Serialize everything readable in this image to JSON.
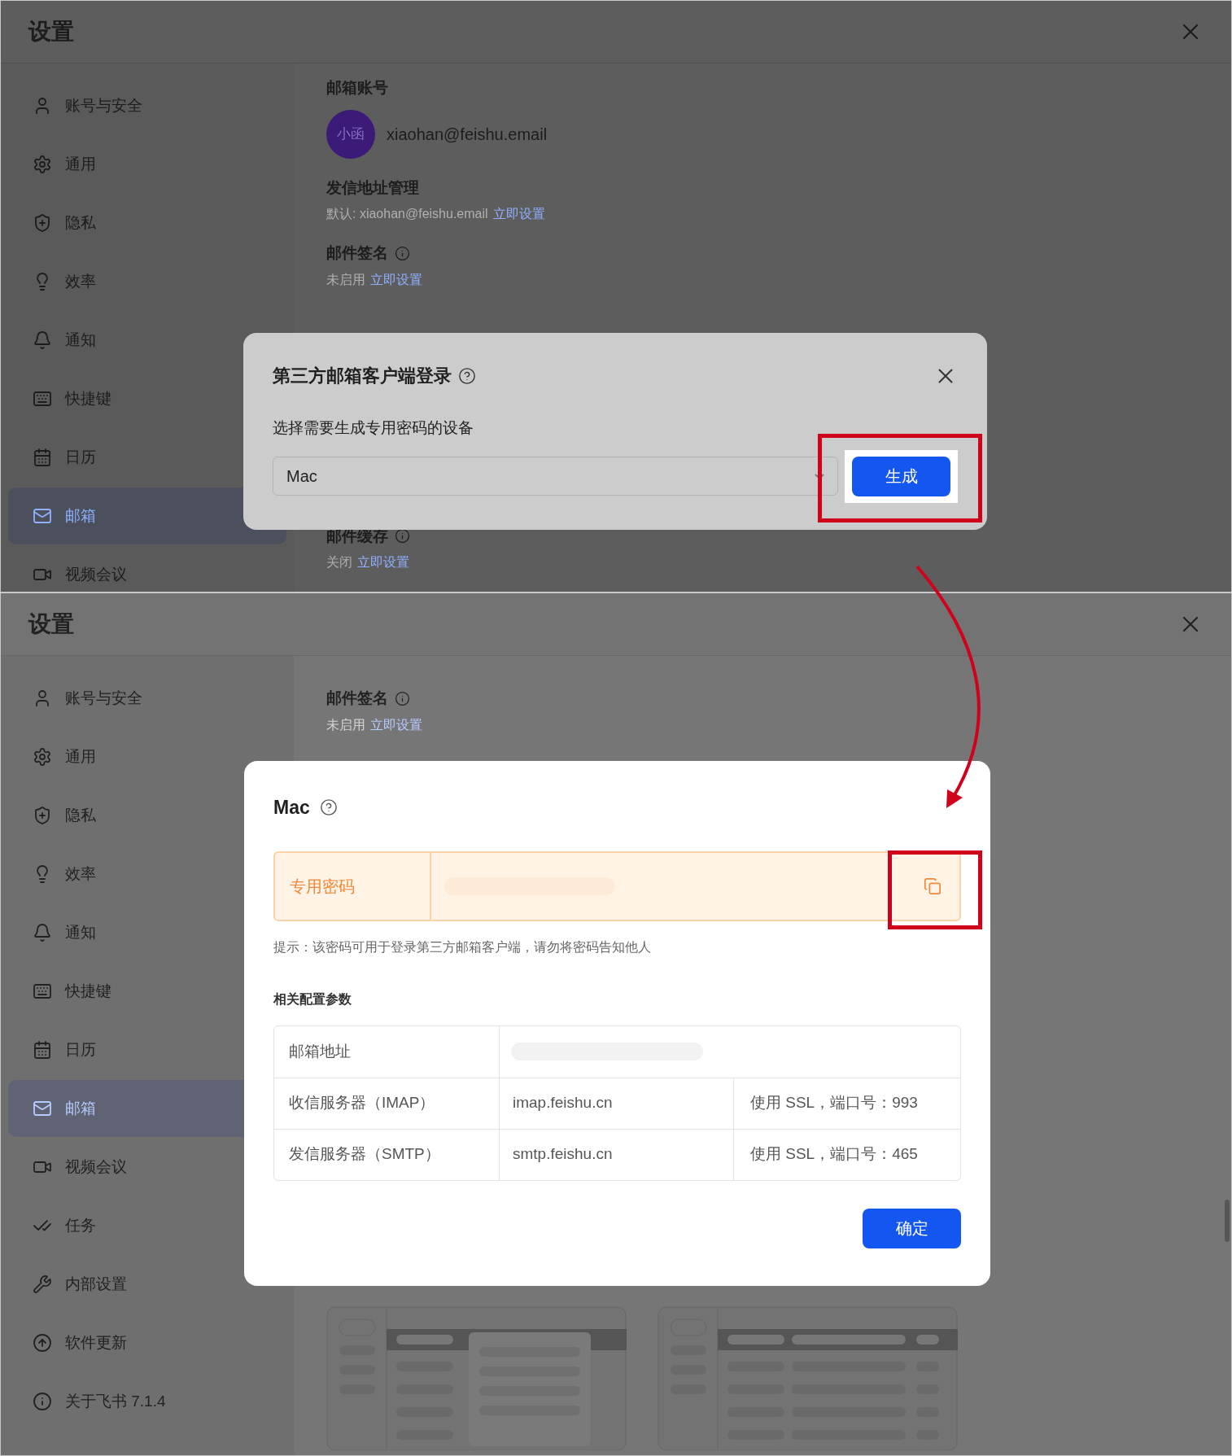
{
  "screens": [
    {
      "window": {
        "title": "设置"
      },
      "sidebar": {
        "items": [
          {
            "label": "账号与安全",
            "selected": false
          },
          {
            "label": "通用",
            "selected": false
          },
          {
            "label": "隐私",
            "selected": false
          },
          {
            "label": "效率",
            "selected": false
          },
          {
            "label": "通知",
            "selected": false
          },
          {
            "label": "快捷键",
            "selected": false
          },
          {
            "label": "日历",
            "selected": false
          },
          {
            "label": "邮箱",
            "selected": true
          },
          {
            "label": "视频会议",
            "selected": false
          }
        ]
      },
      "content": {
        "sections_above": [
          {
            "kind": "account",
            "title": "邮箱账号",
            "avatar": "小函",
            "email": "xiaohan@feishu.email"
          },
          {
            "kind": "setting",
            "title": "发信地址管理",
            "info": false,
            "status": "默认: xiaohan@feishu.email",
            "link": "立即设置"
          },
          {
            "kind": "setting",
            "title": "邮件签名",
            "info": true,
            "status": "未启用",
            "link": "立即设置"
          }
        ],
        "sections_below": [
          {
            "kind": "setting",
            "title": "邮件缓存",
            "info": true,
            "status": "关闭",
            "link": "立即设置"
          }
        ]
      },
      "dialog": {
        "kind": "generate",
        "title": "第三方邮箱客户端登录",
        "help": true,
        "label": "选择需要生成专用密码的设备",
        "select": {
          "value": "Mac"
        },
        "button": "生成"
      }
    },
    {
      "window": {
        "title": "设置"
      },
      "sidebar": {
        "items": [
          {
            "label": "账号与安全",
            "selected": false
          },
          {
            "label": "通用",
            "selected": false
          },
          {
            "label": "隐私",
            "selected": false
          },
          {
            "label": "效率",
            "selected": false
          },
          {
            "label": "通知",
            "selected": false
          },
          {
            "label": "快捷键",
            "selected": false
          },
          {
            "label": "日历",
            "selected": false
          },
          {
            "label": "邮箱",
            "selected": true
          },
          {
            "label": "视频会议",
            "selected": false
          },
          {
            "label": "任务",
            "selected": false
          },
          {
            "label": "内部设置",
            "selected": false
          },
          {
            "label": "软件更新",
            "selected": false
          },
          {
            "label": "关于飞书 7.1.4",
            "selected": false
          }
        ]
      },
      "content": {
        "sections_above": [
          {
            "kind": "setting",
            "title": "邮件签名",
            "info": true,
            "status": "未启用",
            "link": "立即设置"
          }
        ]
      },
      "dialog": {
        "kind": "result",
        "title": "Mac",
        "help": true,
        "password_label": "专用密码",
        "hint": "提示：该密码可用于登录第三方邮箱客户端，请勿将密码告知他人",
        "section": "相关配置参数",
        "table": {
          "rows": [
            [
              "邮箱地址"
            ],
            [
              "收信服务器（IMAP）",
              "imap.feishu.cn",
              "使用 SSL，端口号：993"
            ],
            [
              "发信服务器（SMTP）",
              "smtp.feishu.cn",
              "使用 SSL，端口号：465"
            ]
          ]
        },
        "button": "确定"
      }
    }
  ]
}
